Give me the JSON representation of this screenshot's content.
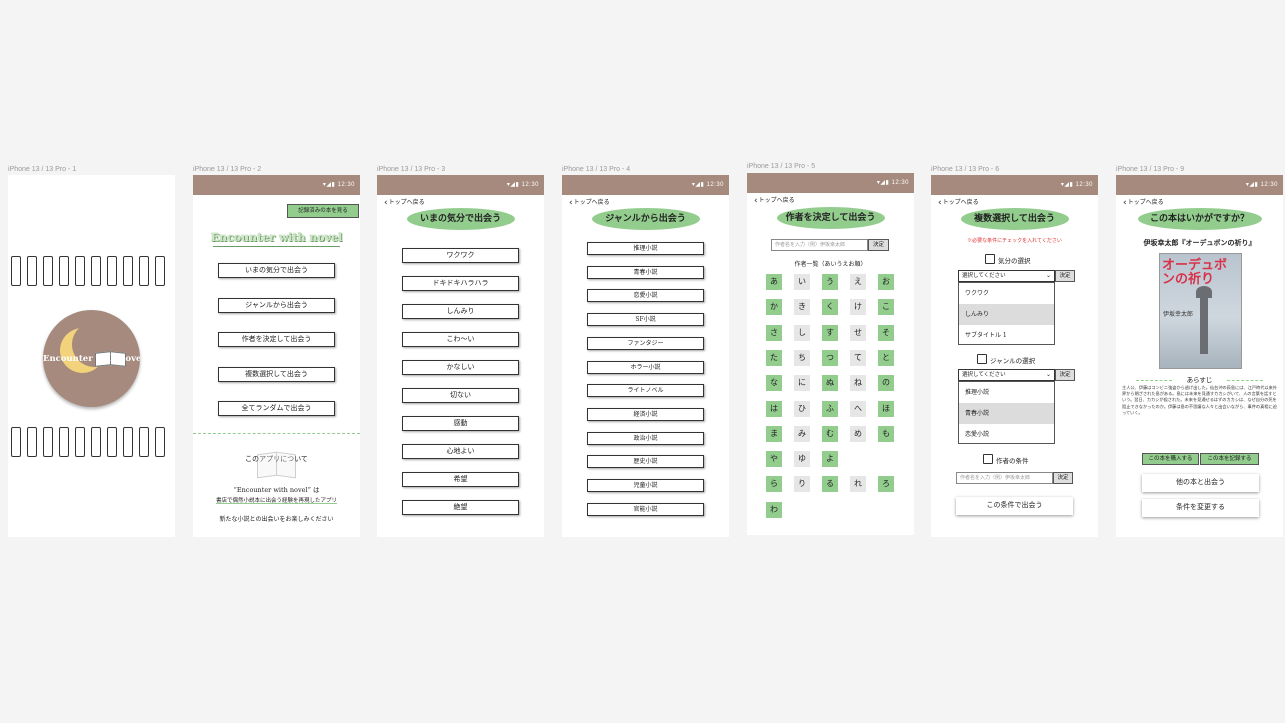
{
  "frames": {
    "f1": {
      "label": "iPhone 13 / 13 Pro - 1",
      "logo_text": "Encounter with novel"
    },
    "f2": {
      "label": "iPhone 13 / 13 Pro - 2",
      "time": "12:30",
      "read_books_button": "記録済みの本を見る",
      "app_title": "Encounter with novel",
      "menu": [
        "いまの気分で出会う",
        "ジャンルから出会う",
        "作者を決定して出会う",
        "複数選択して出会う",
        "全てランダムで出会う"
      ],
      "about_title": "このアプリについて",
      "about_line1": "“Encounter with novel” は",
      "about_line2": "書店で偶然小説本に出会う経験を再現したアプリ",
      "about_line3": "新たな小説との出会いをお楽しみください"
    },
    "f3": {
      "label": "iPhone 13 / 13 Pro - 3",
      "time": "12:30",
      "back": "トップへ戻る",
      "title": "いまの気分で出会う",
      "moods": [
        "ワクワク",
        "ドキドキハラハラ",
        "しんみり",
        "こわ〜い",
        "かなしい",
        "切ない",
        "感動",
        "心地よい",
        "希望",
        "絶望"
      ]
    },
    "f4": {
      "label": "iPhone 13 / 13 Pro - 4",
      "time": "12:30",
      "back": "トップへ戻る",
      "title": "ジャンルから出会う",
      "genres": [
        "推理小説",
        "青春小説",
        "恋愛小説",
        "SF小説",
        "ファンタジー",
        "ホラー小説",
        "ライトノベル",
        "経済小説",
        "政治小説",
        "歴史小説",
        "児童小説",
        "官能小説"
      ]
    },
    "f5": {
      "label": "iPhone 13 / 13 Pro - 5",
      "time": "12:30",
      "back": "トップへ戻る",
      "title": "作者を決定して出会う",
      "author_placeholder": "作者名を入力（例）伊坂幸太郎",
      "decide": "決定",
      "list_title": "作者一覧（あいうえお順）",
      "kana_rows": [
        [
          "あ",
          "い",
          "う",
          "え",
          "お"
        ],
        [
          "か",
          "き",
          "く",
          "け",
          "こ"
        ],
        [
          "さ",
          "し",
          "す",
          "せ",
          "そ"
        ],
        [
          "た",
          "ち",
          "つ",
          "て",
          "と"
        ],
        [
          "な",
          "に",
          "ぬ",
          "ね",
          "の"
        ],
        [
          "は",
          "ひ",
          "ふ",
          "へ",
          "ほ"
        ],
        [
          "ま",
          "み",
          "む",
          "め",
          "も"
        ],
        [
          "や",
          "ゆ",
          "よ"
        ],
        [
          "ら",
          "り",
          "る",
          "れ",
          "ろ"
        ],
        [
          "わ"
        ]
      ]
    },
    "f6": {
      "label": "iPhone 13 / 13 Pro - 6",
      "time": "12:30",
      "back": "トップへ戻る",
      "title": "複数選択して出会う",
      "warning": "※必要な条件にチェックを入れてください",
      "mood_label": "気分の選択",
      "select_placeholder": "選択してください",
      "decide": "決定",
      "mood_options": [
        "ワクワク",
        "しんみり",
        "サブタイトル 1"
      ],
      "genre_label": "ジャンルの選択",
      "genre_options": [
        "推理小説",
        "青春小説",
        "恋愛小説"
      ],
      "author_label": "作者の条件",
      "author_placeholder": "作者名を入力（例）伊坂幸太郎",
      "submit": "この条件で出会う"
    },
    "f7": {
      "label": "iPhone 13 / 13 Pro - 9",
      "time": "12:30",
      "back": "トップへ戻る",
      "title": "この本はいかがですか？",
      "book": "伊坂幸太郎『オーデュボンの祈り』",
      "cover_title": "オーデュボンの祈り",
      "cover_author": "伊坂幸太郎",
      "synopsis_title": "あらすじ",
      "synopsis": "主人公、伊藤はコンビニ強盗から逃げ出した。仙台沖の荻島には、江戸時代以来外界から閉ざされた島がある。島には未来を見通すカカシがいて、人の言葉を話すという。翌日、カカシが殺された。未来を見通せるはずのカカシは、なぜ自分の死を阻止できなかったのか。伊藤は島の不思議な人々と出会いながら、事件の真相に迫っていく。",
      "buy": "この本を購入する",
      "record": "この本を記録する",
      "other": "他の本と出会う",
      "change": "条件を変更する"
    }
  }
}
